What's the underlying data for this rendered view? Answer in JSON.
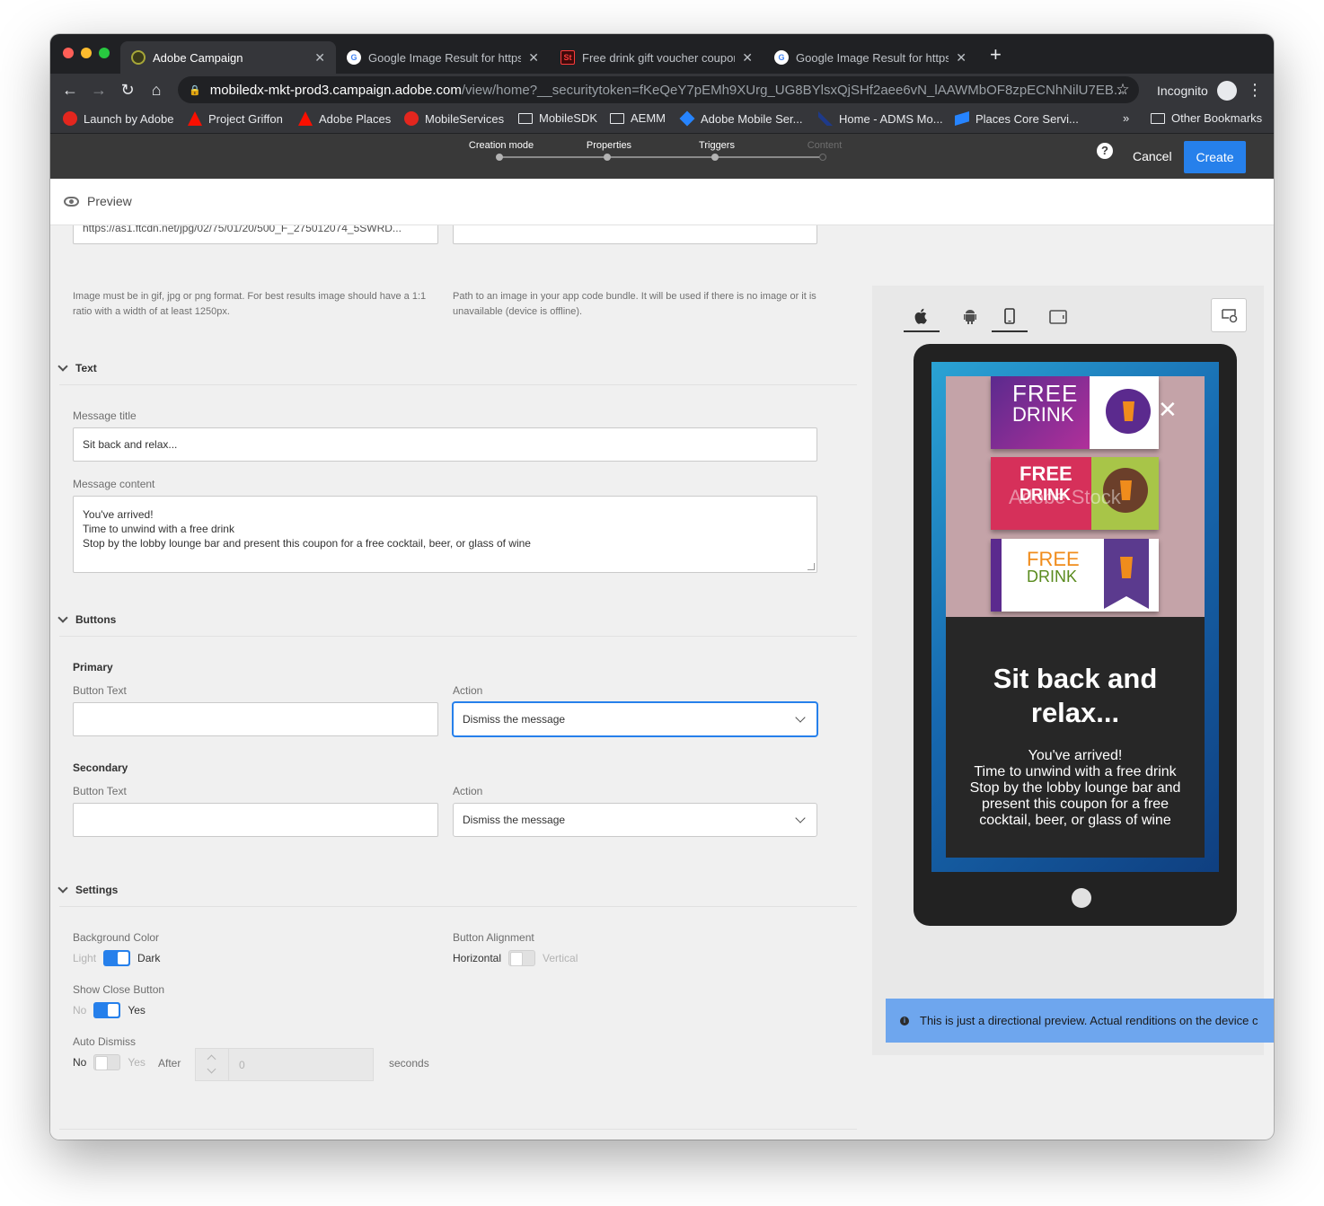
{
  "browser": {
    "tabs": [
      {
        "title": "Adobe Campaign"
      },
      {
        "title": "Google Image Result for https:/"
      },
      {
        "title": "Free drink gift voucher coupon"
      },
      {
        "title": "Google Image Result for https:/"
      }
    ],
    "url_host": "mobiledx-mkt-prod3.campaign.adobe.com",
    "url_path": "/view/home?__securitytoken=fKeQeY7pEMh9XUrg_UG8BYlsxQjSHf2aee6vN_lAAWMbOF8zpECNhNilU7EB...",
    "incognito_label": "Incognito",
    "bookmarks": [
      {
        "label": "Launch by Adobe",
        "icon": "launch-icon"
      },
      {
        "label": "Project Griffon",
        "icon": "adobe-icon"
      },
      {
        "label": "Adobe Places",
        "icon": "adobe-icon"
      },
      {
        "label": "MobileServices",
        "icon": "launch-icon"
      },
      {
        "label": "MobileSDK",
        "icon": "folder-icon"
      },
      {
        "label": "AEMM",
        "icon": "folder-icon"
      },
      {
        "label": "Adobe Mobile Ser...",
        "icon": "jira-icon"
      },
      {
        "label": "Home - ADMS Mo...",
        "icon": "confluence-icon"
      },
      {
        "label": "Places Core Servi...",
        "icon": "confluence-icon"
      }
    ],
    "more_bookmarks": "»",
    "other_bookmarks": "Other Bookmarks"
  },
  "wizard": {
    "steps": [
      {
        "label": "Creation mode",
        "enabled": true
      },
      {
        "label": "Properties",
        "enabled": true
      },
      {
        "label": "Triggers",
        "enabled": true
      },
      {
        "label": "Content",
        "enabled": false
      }
    ],
    "help_glyph": "?",
    "cancel_label": "Cancel",
    "create_label": "Create"
  },
  "preview_label": "Preview",
  "media": {
    "image_url_value": "https://as1.ftcdn.net/jpg/02/75/01/20/500_F_275012074_5SWRD...",
    "image_help": "Image must be in gif, jpg or png format. For best results image should have a 1:1 ratio with a width of at least 1250px.",
    "default_image_help": "Path to an image in your app code bundle. It will be used if there is no image or it is unavailable (device is offline)."
  },
  "text_section": {
    "heading": "Text",
    "title_label": "Message title",
    "title_value": "Sit back and relax...",
    "content_label": "Message content",
    "content_line1": "You've arrived!",
    "content_line2": "Time to unwind with a free drink",
    "content_line3": "Stop by the lobby lounge bar and present this coupon for a free cocktail, beer, or glass of wine"
  },
  "buttons_section": {
    "heading": "Buttons",
    "primary": {
      "heading": "Primary",
      "text_label": "Button Text",
      "action_label": "Action",
      "action_value": "Dismiss the message"
    },
    "secondary": {
      "heading": "Secondary",
      "text_label": "Button Text",
      "action_label": "Action",
      "action_value": "Dismiss the message"
    }
  },
  "settings_section": {
    "heading": "Settings",
    "bg_color_label": "Background Color",
    "bg_off": "Light",
    "bg_on": "Dark",
    "bg_checked": true,
    "alignment_label": "Button Alignment",
    "align_left": "Horizontal",
    "align_right": "Vertical",
    "close_label": "Show Close Button",
    "close_off": "No",
    "close_on": "Yes",
    "auto_dismiss_label": "Auto Dismiss",
    "dismiss_no": "No",
    "dismiss_yes": "Yes",
    "after_label": "After",
    "seconds_value": "0",
    "seconds_label": "seconds"
  },
  "preview_panel": {
    "platforms": [
      "apple-icon",
      "android-icon",
      "phone-icon",
      "tablet-icon"
    ],
    "message_title": "Sit back and relax...",
    "message_body_line1": "You've arrived!",
    "message_body_line2": "Time to unwind with a free drink",
    "message_body_line3": "Stop by the lobby lounge bar and present this coupon for a free cocktail, beer, or glass of wine",
    "close_glyph": "✕",
    "coupon_free": "FREE",
    "coupon_drink": "DRINK",
    "watermark": "Adobe Stock",
    "info_text": "This is just a directional preview. Actual renditions on the device c"
  },
  "colors": {
    "accent": "#2680eb",
    "app_header": "#393939",
    "info_bar": "#6ea6ee"
  }
}
